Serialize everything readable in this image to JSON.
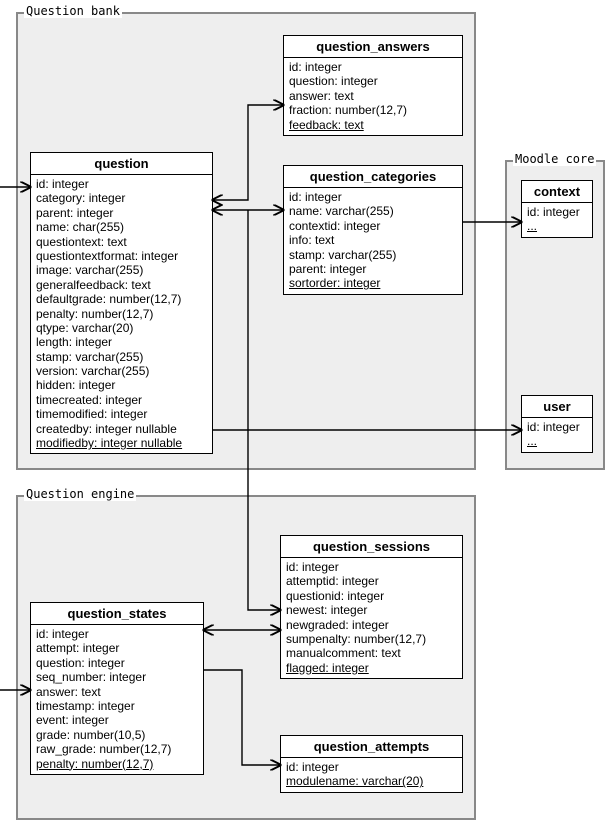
{
  "groups": {
    "question_bank": {
      "label": "Question bank"
    },
    "moodle_core": {
      "label": "Moodle core"
    },
    "question_engine": {
      "label": "Question engine"
    }
  },
  "entities": {
    "question": {
      "title": "question",
      "fields": [
        "id: integer",
        "category: integer",
        "parent: integer",
        "name: char(255)",
        "questiontext: text",
        "questiontextformat: integer",
        "image: varchar(255)",
        "generalfeedback: text",
        "defaultgrade: number(12,7)",
        "penalty: number(12,7)",
        "qtype: varchar(20)",
        "length: integer",
        "stamp: varchar(255)",
        "version: varchar(255)",
        "hidden: integer",
        "timecreated: integer",
        "timemodified: integer",
        "createdby: integer nullable",
        "modifiedby: integer nullable"
      ]
    },
    "question_answers": {
      "title": "question_answers",
      "fields": [
        "id: integer",
        "question: integer",
        "answer: text",
        "fraction: number(12,7)",
        "feedback: text"
      ]
    },
    "question_categories": {
      "title": "question_categories",
      "fields": [
        "id: integer",
        "name: varchar(255)",
        "contextid: integer",
        "info: text",
        "stamp: varchar(255)",
        "parent: integer",
        "sortorder: integer"
      ]
    },
    "context": {
      "title": "context",
      "fields": [
        "id: integer",
        "..."
      ]
    },
    "user": {
      "title": "user",
      "fields": [
        "id: integer",
        "..."
      ]
    },
    "question_states": {
      "title": "question_states",
      "fields": [
        "id: integer",
        "attempt: integer",
        "question: integer",
        "seq_number: integer",
        "answer: text",
        "timestamp: integer",
        "event: integer",
        "grade: number(10,5)",
        "raw_grade: number(12,7)",
        "penalty: number(12,7)"
      ]
    },
    "question_sessions": {
      "title": "question_sessions",
      "fields": [
        "id: integer",
        "attemptid: integer",
        "questionid: integer",
        "newest: integer",
        "newgraded: integer",
        "sumpenalty: number(12,7)",
        "manualcomment: text",
        "flagged: integer"
      ]
    },
    "question_attempts": {
      "title": "question_attempts",
      "fields": [
        "id: integer",
        "modulename: varchar(20)"
      ]
    }
  }
}
